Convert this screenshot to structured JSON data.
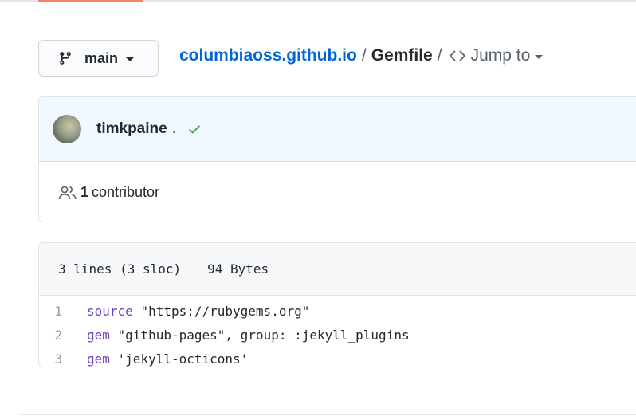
{
  "branch": {
    "name": "main",
    "icon": "git-branch-icon"
  },
  "breadcrumb": {
    "repo": "columbiaoss.github.io",
    "separator": "/",
    "file": "Gemfile",
    "jump_label": "Jump to"
  },
  "commit": {
    "author": "timkpaine",
    "suffix": ".",
    "status": "success",
    "status_color": "#28a745"
  },
  "contributors": {
    "count": "1",
    "label": "contributor"
  },
  "file_info": {
    "lines": "3 lines (3 sloc)",
    "size": "94 Bytes"
  },
  "code": [
    {
      "num": "1",
      "keyword": "source",
      "rest": " \"https://rubygems.org\""
    },
    {
      "num": "2",
      "keyword": "gem",
      "rest": " \"github-pages\", group: :jekyll_plugins"
    },
    {
      "num": "3",
      "keyword": "gem",
      "rest": " 'jekyll-octicons'"
    }
  ],
  "colors": {
    "link": "#0366d6",
    "keyword": "#6f42c1",
    "string": "#032f62",
    "tab_accent": "#f9826c"
  }
}
